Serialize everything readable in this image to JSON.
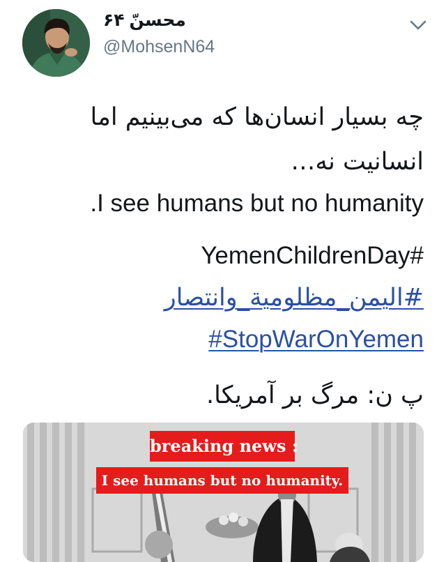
{
  "author": {
    "display_name": "محسنّ ۶۴",
    "handle": "@MohsenN64"
  },
  "tweet": {
    "line1": "چه بسیار انسان‌ها که می‌بینیم اما",
    "line2": "انسانیت نه…",
    "line3": ".I see humans but no humanity",
    "hashtag1": "YemenChildrenDay#",
    "hashtag2": "#اليمن_مظلومية_وانتصار",
    "hashtag3": "#StopWarOnYemen",
    "footnote": "پ ن: مرگ بر آمریکا."
  },
  "media": {
    "headline": "breaking news :",
    "subheadline": "I see humans but no humanity."
  },
  "icons": {
    "more": "chevron-down-icon"
  },
  "colors": {
    "link": "#2b4fa3",
    "handle": "#657786",
    "news_banner": "#e41c1c"
  }
}
